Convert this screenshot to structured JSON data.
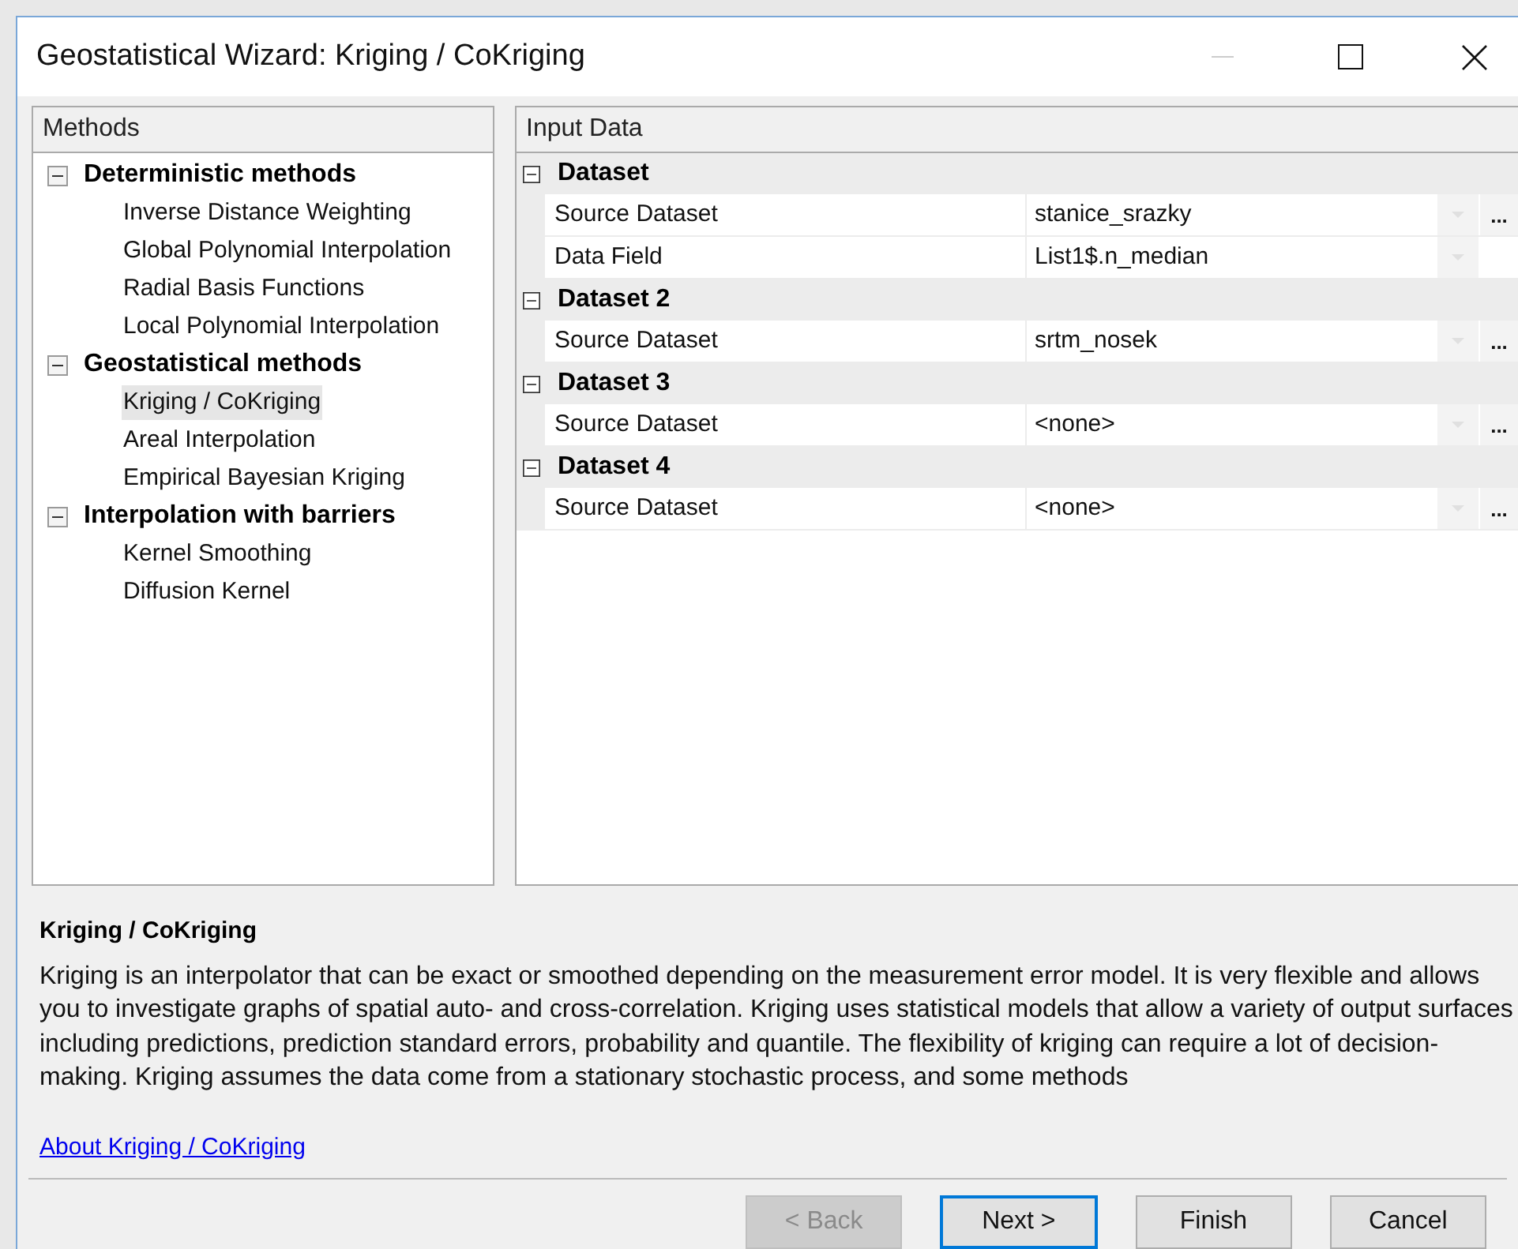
{
  "window": {
    "title": "Geostatistical Wizard: Kriging / CoKriging"
  },
  "methods": {
    "header": "Methods",
    "groups": [
      {
        "label": "Deterministic methods",
        "expanded": true,
        "children": [
          {
            "label": "Inverse Distance Weighting",
            "selected": false
          },
          {
            "label": "Global Polynomial Interpolation",
            "selected": false
          },
          {
            "label": "Radial Basis Functions",
            "selected": false
          },
          {
            "label": "Local Polynomial Interpolation",
            "selected": false
          }
        ]
      },
      {
        "label": "Geostatistical methods",
        "expanded": true,
        "children": [
          {
            "label": "Kriging / CoKriging",
            "selected": true
          },
          {
            "label": "Areal Interpolation",
            "selected": false
          },
          {
            "label": "Empirical Bayesian Kriging",
            "selected": false
          }
        ]
      },
      {
        "label": "Interpolation with barriers",
        "expanded": true,
        "children": [
          {
            "label": "Kernel Smoothing",
            "selected": false
          },
          {
            "label": "Diffusion Kernel",
            "selected": false
          }
        ]
      }
    ]
  },
  "input_data": {
    "header": "Input Data",
    "categories": [
      {
        "label": "Dataset",
        "expanded": true,
        "rows": [
          {
            "name": "Source Dataset",
            "value": "stanice_srazky",
            "browse": "..."
          },
          {
            "name": "Data Field",
            "value": "List1$.n_median"
          }
        ]
      },
      {
        "label": "Dataset 2",
        "expanded": true,
        "rows": [
          {
            "name": "Source Dataset",
            "value": "srtm_nosek",
            "browse": "..."
          }
        ]
      },
      {
        "label": "Dataset 3",
        "expanded": true,
        "rows": [
          {
            "name": "Source Dataset",
            "value": "<none>",
            "browse": "..."
          }
        ]
      },
      {
        "label": "Dataset 4",
        "expanded": true,
        "rows": [
          {
            "name": "Source Dataset",
            "value": "<none>",
            "browse": "..."
          }
        ]
      }
    ]
  },
  "description": {
    "title": "Kriging / CoKriging",
    "text": "Kriging is an interpolator that can be exact or smoothed depending on the measurement error model. It is very flexible and allows you to investigate graphs of spatial auto- and cross-correlation. Kriging uses statistical models that allow a variety of output surfaces including predictions, prediction standard errors, probability and quantile. The flexibility of kriging can require a lot of decision-making. Kriging assumes the data come from a stationary stochastic process, and some methods",
    "link": "About Kriging / CoKriging"
  },
  "buttons": [
    {
      "label": "< Back",
      "disabled": true,
      "default": false
    },
    {
      "label": "Next >",
      "disabled": false,
      "default": true
    },
    {
      "label": "Finish",
      "disabled": false,
      "default": false
    },
    {
      "label": "Cancel",
      "disabled": false,
      "default": false
    }
  ]
}
